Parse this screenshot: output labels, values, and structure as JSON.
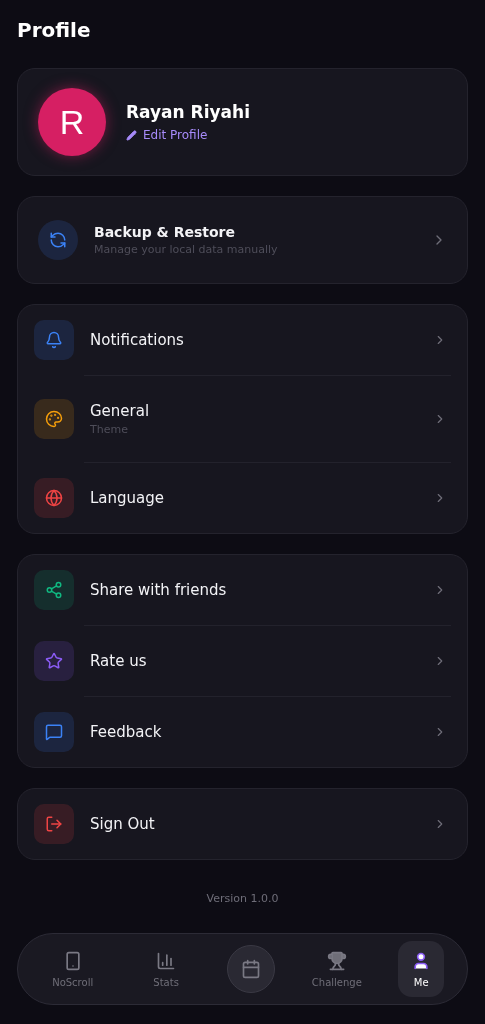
{
  "title": "Profile",
  "profile": {
    "initial": "R",
    "name": "Rayan Riyahi",
    "edit_label": "Edit Profile"
  },
  "backup": {
    "title": "Backup & Restore",
    "subtitle": "Manage your local data manually"
  },
  "groups": [
    {
      "items": [
        {
          "kind": "bell",
          "label": "Notifications",
          "color": "#3b82f6"
        },
        {
          "kind": "palette",
          "label": "General",
          "subtitle": "Theme",
          "color": "#f59e0b"
        },
        {
          "kind": "globe",
          "label": "Language",
          "color": "#ef4444"
        }
      ]
    },
    {
      "items": [
        {
          "kind": "share",
          "label": "Share with friends",
          "color": "#10b981"
        },
        {
          "kind": "star",
          "label": "Rate us",
          "color": "#8b5cf6"
        },
        {
          "kind": "message",
          "label": "Feedback",
          "color": "#3b82f6"
        }
      ]
    },
    {
      "items": [
        {
          "kind": "logout",
          "label": "Sign Out",
          "color": "#ef4444"
        }
      ]
    }
  ],
  "version": "Version 1.0.0",
  "nav": [
    {
      "kind": "phone",
      "label": "NoScroll",
      "selected": false
    },
    {
      "kind": "stats",
      "label": "Stats",
      "selected": false
    },
    {
      "kind": "calendar",
      "selected": false
    },
    {
      "kind": "trophy",
      "label": "Challenge",
      "selected": false
    },
    {
      "kind": "user",
      "label": "Me",
      "selected": true
    }
  ]
}
